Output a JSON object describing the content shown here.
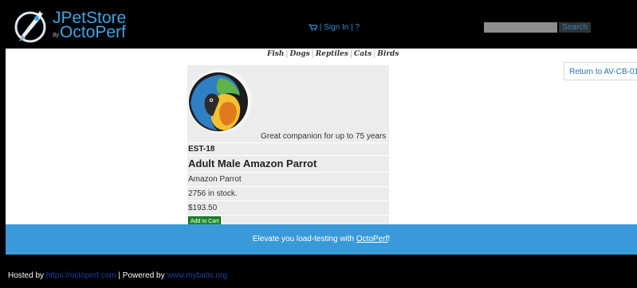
{
  "header": {
    "logo": {
      "line1": "JPetStore",
      "by": "By",
      "line2": "OctoPerf"
    },
    "menu": {
      "sign_in": "Sign In",
      "help": "?",
      "separator": "|"
    },
    "search": {
      "placeholder": "",
      "button_label": "Search"
    }
  },
  "quicklinks": [
    "Fish",
    "Dogs",
    "Reptiles",
    "Cats",
    "Birds"
  ],
  "return_button": "Return to AV-CB-01",
  "product": {
    "description": "Great companion for up to 75 years",
    "item_id": "EST-18",
    "name": "Adult Male Amazon Parrot",
    "product_name": "Amazon Parrot",
    "stock": "2756 in stock.",
    "price": "$193.50",
    "add_to_cart_label": "Add to Cart"
  },
  "band": {
    "text": "Elevate you load-testing with ",
    "link": "OctoPerf",
    "suffix": "!"
  },
  "footer": {
    "hosted_by": "Hosted by ",
    "hosted_link": "https://octoperf.com",
    "powered_by": " | Powered by ",
    "powered_link": "www.mybatis.org"
  },
  "colors": {
    "brand_blue": "#3ea6e5",
    "band_blue": "#3a9ad9",
    "add_to_cart_green": "#1a8a2a"
  },
  "icons": {
    "logo": "rocket-logo-icon",
    "cart": "cart-icon"
  }
}
